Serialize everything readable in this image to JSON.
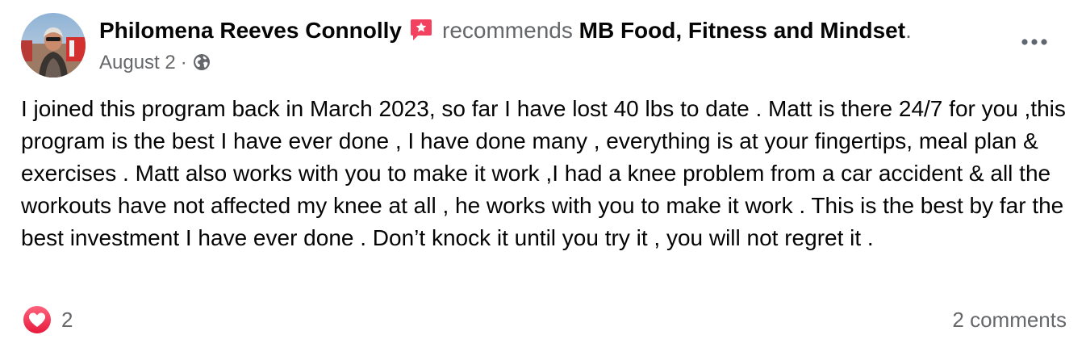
{
  "post": {
    "author_name": "Philomena Reeves Connolly",
    "verb": "recommends",
    "page_name": "MB Food, Fitness and Mindset",
    "period": ".",
    "date": "August 2",
    "meta_separator": "·",
    "privacy_icon": "globe-icon",
    "recommend_icon": "recommendation-badge-icon",
    "more_icon": "more-options-icon",
    "body": "I joined this program back in March 2023, so far I have lost 40 lbs to date . Matt is there 24/7 for you ,this program is the best I have ever done , I have done many , everything is at your fingertips, meal plan & exercises . Matt also works with you to make it work ,I had a knee problem from a car accident & all the workouts have not affected my knee at all , he works with you to make it work . This is the best by far the best investment I have ever done . Don’t knock it until you try it , you will not regret it ."
  },
  "footer": {
    "reaction_icon": "love-reaction-icon",
    "reaction_count": "2",
    "comments_label": "2 comments"
  },
  "colors": {
    "text_primary": "#050505",
    "text_secondary": "#65676b",
    "recommend_badge": "#f3425f",
    "love_reaction": "#f33e58"
  }
}
